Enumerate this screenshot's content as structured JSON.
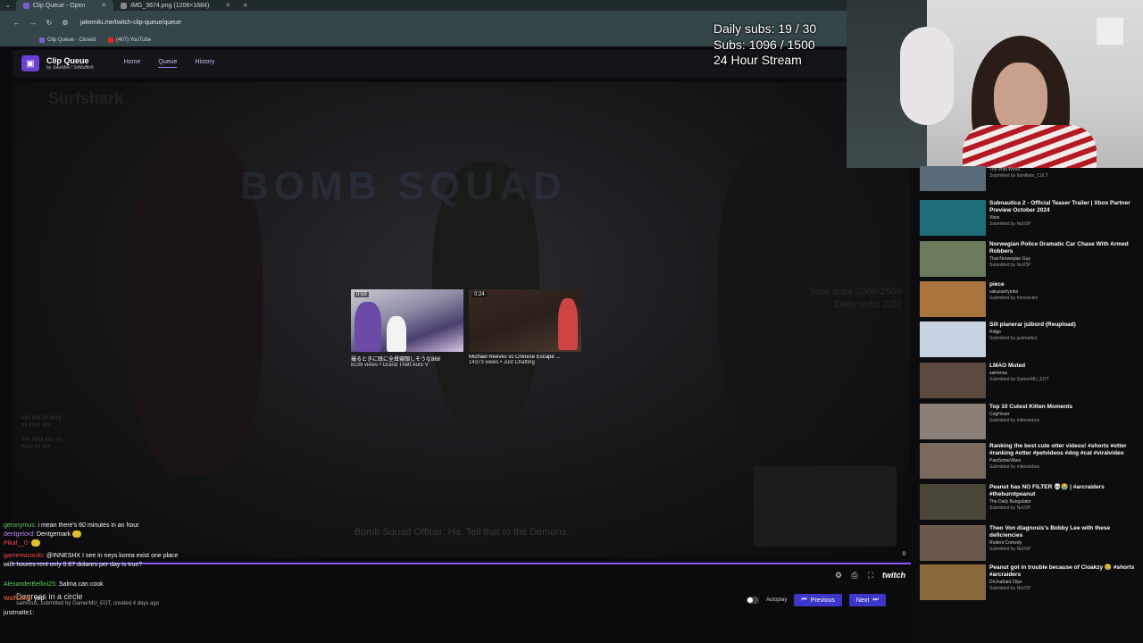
{
  "browser": {
    "tabs": [
      {
        "title": "Clip Queue - Open",
        "active": true
      },
      {
        "title": "IMG_3674.png (1206×1684)",
        "active": false
      }
    ],
    "url": "jakemiki.me/twitch-clip-queue/queue",
    "bookmarks": [
      "Clip Queue - Closed",
      "(407) YouTube"
    ]
  },
  "site": {
    "title": "Clip Queue",
    "byline": "by JakeMiki / SirMuffin9",
    "nav": [
      "Home",
      "Queue",
      "History"
    ],
    "active_nav": "Queue"
  },
  "overlay": {
    "daily_subs": "Daily subs: 19 / 30",
    "subs": "Subs: 1096 / 1500",
    "stream": "24 Hour Stream"
  },
  "video": {
    "watermark": "Surfshark",
    "bigtext": "BOMB SQUAD",
    "faint_text": [
      "Total subs 2008/2500",
      "Daily subs 2/30"
    ],
    "subtitle": "Bomb Squad Officer: Ha. Tell that to the Demons.",
    "volume_level": "0",
    "endcards": [
      {
        "duration": "0:59",
        "title": "撮るときに既に全員寝顔しそうな868",
        "meta": "8239 views • Grand Theft Auto V"
      },
      {
        "duration": "0:24",
        "title": "Michael Reeves vs Chinese Escape ...",
        "meta": "14373 views • Just Chatting"
      }
    ]
  },
  "player": {
    "brand": "twitch",
    "clip_title": "Degrees in a circle",
    "clip_meta": "saimmus, submitted by GamerMU_EOT, created 4 days ago",
    "autoplay_label": "Autoplay",
    "previous_label": "Previous",
    "next_label": "Next"
  },
  "queue": [
    {
      "title": "The Wild World",
      "channel": "",
      "submitter": "Submitted by Ilamillam_CULT",
      "color": "#5a6b7a"
    },
    {
      "title": "Subnautica 2 - Official Teaser Trailer | Xbox Partner Preview October 2024",
      "channel": "Xbox",
      "submitter": "Submitted by NaV3P",
      "color": "#1e6d7a"
    },
    {
      "title": "Norwegian Police Dramatic Car Chase With Armed Robbers",
      "channel": "That Norwegian Guy",
      "submitter": "Submitted by NaV3P",
      "color": "#6a7a5a"
    },
    {
      "title": "piece",
      "channel": "sakurashymko",
      "submitter": "Submitted by fomovictim",
      "color": "#a8743c"
    },
    {
      "title": "Sill planerar julbord (Reupload)",
      "channel": "Ridge",
      "submitter": "Submitted by justmatte1",
      "color": "#c7d3e0"
    },
    {
      "title": "LMAO Muted",
      "channel": "saimmus",
      "submitter": "Submitted by GamerMU_EOT",
      "color": "#5a4a40"
    },
    {
      "title": "Top 10 Cutest Kitten Moments",
      "channel": "CogHover",
      "submitter": "Submitted by mikeumbox",
      "color": "#8a8078"
    },
    {
      "title": "Ranking the best cute otter videos! #shorts #otter #ranking #otter #petvideos #dog #cat #viralvideo",
      "channel": "PawSomeVibes",
      "submitter": "Submitted by mikeumbox",
      "color": "#7a6a5e"
    },
    {
      "title": "Peanut has NO FILTER 💀😭 | #arcraiders #theburntpeanut",
      "channel": "The Daily Bungulator",
      "submitter": "Submitted by NaV3P",
      "color": "#4a4638"
    },
    {
      "title": "Theo Von diagnosis's Bobby Lee with these deficiencies",
      "channel": "Rodent Comedy",
      "submitter": "Submitted by NaV3P",
      "color": "#6a5a4c"
    },
    {
      "title": "Peanut got in trouble because of Cloakzy 😢 #shorts #arcraiders",
      "channel": "DrUnafraid Clips",
      "submitter": "Submitted by NaV3P",
      "color": "#8a6a3a"
    }
  ],
  "chat": [
    {
      "user": "geronymus:",
      "text": " i mean there's 60 minutes in an hour",
      "color": "user-green"
    },
    {
      "user": "dentgelord:",
      "text": " Dentgemark",
      "color": "user-purple"
    },
    {
      "user": "Pikal__0:",
      "text": "",
      "color": "user-red"
    },
    {
      "user": "gamerwizardo:",
      "text": " @INNESHX I see in neys korea exist one place with houres rent only 0.67 dolares per day is true?",
      "color": "user-red"
    },
    {
      "user": "AlexanderBellini25:",
      "text": " Salma can cook",
      "color": "user-green"
    },
    {
      "user": "WolfCake:",
      "text": " yep",
      "color": "user-orange"
    },
    {
      "user": "justmatte1:",
      "text": "",
      "color": "user-white"
    }
  ]
}
